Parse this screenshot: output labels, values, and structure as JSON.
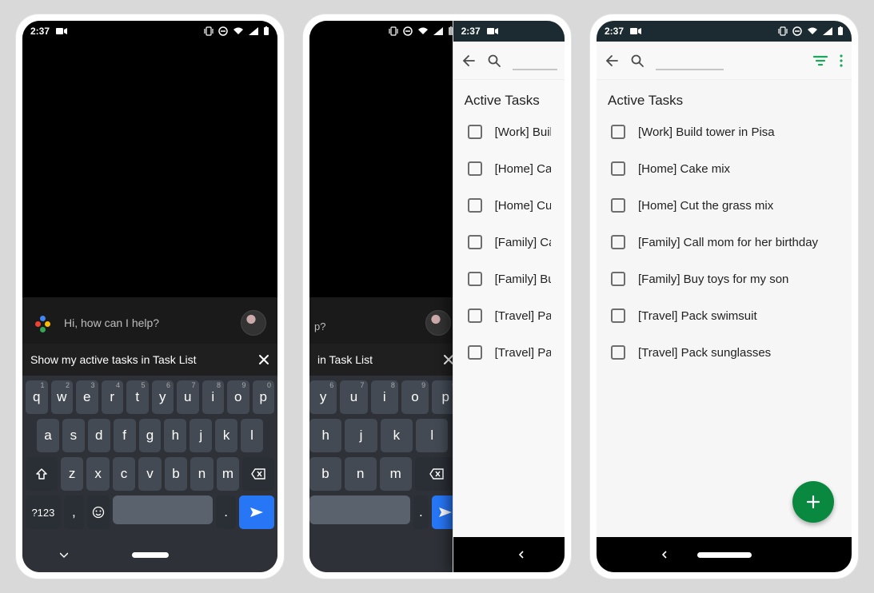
{
  "status": {
    "time": "2:37",
    "camera": "cam"
  },
  "assistant": {
    "greeting": "Hi, how can I help?",
    "query_full": "Show my active tasks in Task List",
    "query_suffix": "in Task List",
    "greeting_suffix": "p?"
  },
  "keyboard": {
    "row1": [
      "q",
      "w",
      "e",
      "r",
      "t",
      "y",
      "u",
      "i",
      "o",
      "p"
    ],
    "sup1": [
      "1",
      "2",
      "3",
      "4",
      "5",
      "6",
      "7",
      "8",
      "9",
      "0"
    ],
    "row2": [
      "a",
      "s",
      "d",
      "f",
      "g",
      "h",
      "j",
      "k",
      "l"
    ],
    "row3": [
      "z",
      "x",
      "c",
      "v",
      "b",
      "n",
      "m"
    ],
    "sym": "?123",
    "comma": ",",
    "period": "."
  },
  "tasks": {
    "header": "Active Tasks",
    "items": [
      "[Work] Build tower in Pisa",
      "[Home] Cake mix",
      "[Home] Cut the grass mix",
      "[Family] Call mom for her birthday",
      "[Family] Buy toys for my son",
      "[Travel] Pack swimsuit",
      "[Travel] Pack sunglasses"
    ],
    "items_clipped": [
      "[Work] Build t",
      "[Home] Cake",
      "[Home] Cut th",
      "[Family] Call m",
      "[Family] Buy t",
      "[Travel] Pack s",
      "[Travel] Pack s"
    ]
  }
}
